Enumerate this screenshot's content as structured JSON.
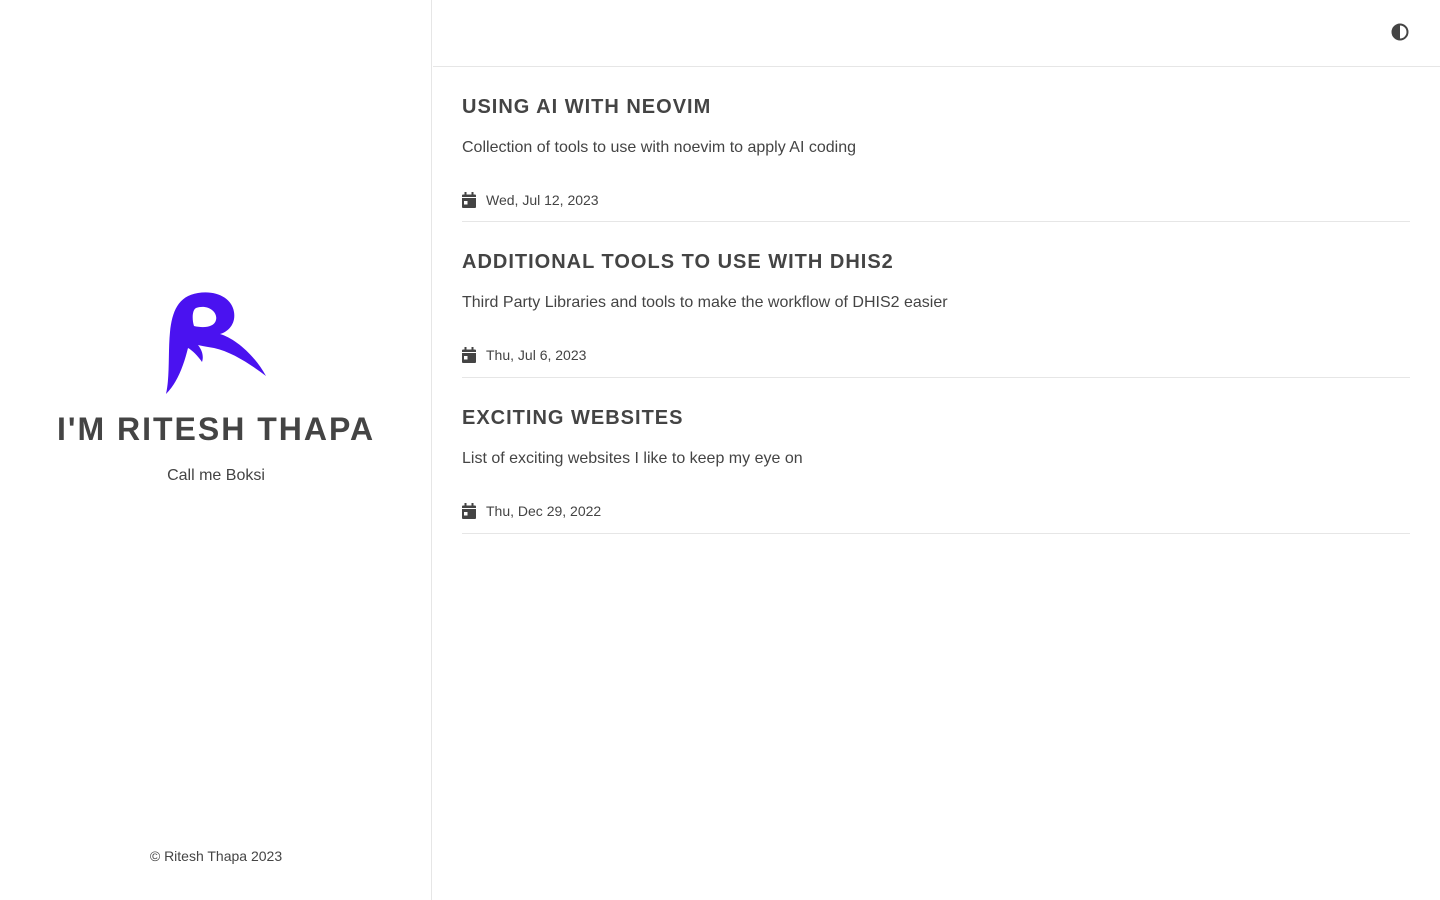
{
  "sidebar": {
    "logo_color": "#4a12f0",
    "author_name": "I'M RITESH THAPA",
    "tagline": "Call me Boksi",
    "footer": "© Ritesh Thapa 2023"
  },
  "topbar": {
    "theme_toggle_icon": "contrast-icon"
  },
  "posts": [
    {
      "title": "USING AI WITH NEOVIM",
      "description": "Collection of tools to use with noevim to apply AI coding",
      "date": "Wed, Jul 12, 2023"
    },
    {
      "title": "ADDITIONAL TOOLS TO USE WITH DHIS2",
      "description": "Third Party Libraries and tools to make the workflow of DHIS2 easier",
      "date": "Thu, Jul 6, 2023"
    },
    {
      "title": "EXCITING WEBSITES",
      "description": "List of exciting websites I like to keep my eye on",
      "date": "Thu, Dec 29, 2022"
    }
  ],
  "colors": {
    "text": "#444444",
    "divider": "#e6e6e6",
    "accent": "#4a12f0"
  }
}
